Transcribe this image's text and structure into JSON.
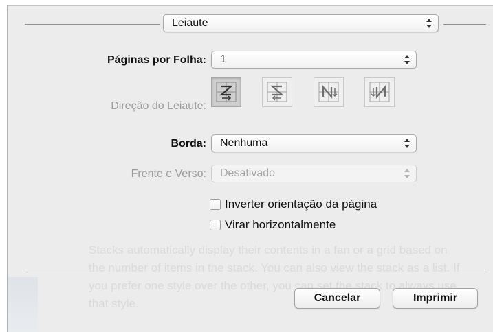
{
  "header": {
    "section_popup": "Leiaute"
  },
  "fields": {
    "pages_per_sheet": {
      "label": "Páginas por Folha:",
      "value": "1"
    },
    "layout_direction": {
      "label": "Direção do Leiaute:",
      "options": [
        "z-right-down",
        "z-left-down",
        "n-down-right",
        "n-down-left"
      ],
      "selected_index": 0
    },
    "border": {
      "label": "Borda:",
      "value": "Nenhuma"
    },
    "two_sided": {
      "label": "Frente e Verso:",
      "value": "Desativado",
      "enabled": false
    }
  },
  "checkboxes": [
    {
      "label": "Inverter orientação da página",
      "checked": false
    },
    {
      "label": "Virar horizontalmente",
      "checked": false
    }
  ],
  "buttons": {
    "cancel": "Cancelar",
    "print": "Imprimir"
  },
  "background_text": "Stacks automatically display their contents in a fan or a grid based on the number of items in the stack. You can also view the stack as a list. If you prefer one style over the other, you can set the stack to always use that style."
}
